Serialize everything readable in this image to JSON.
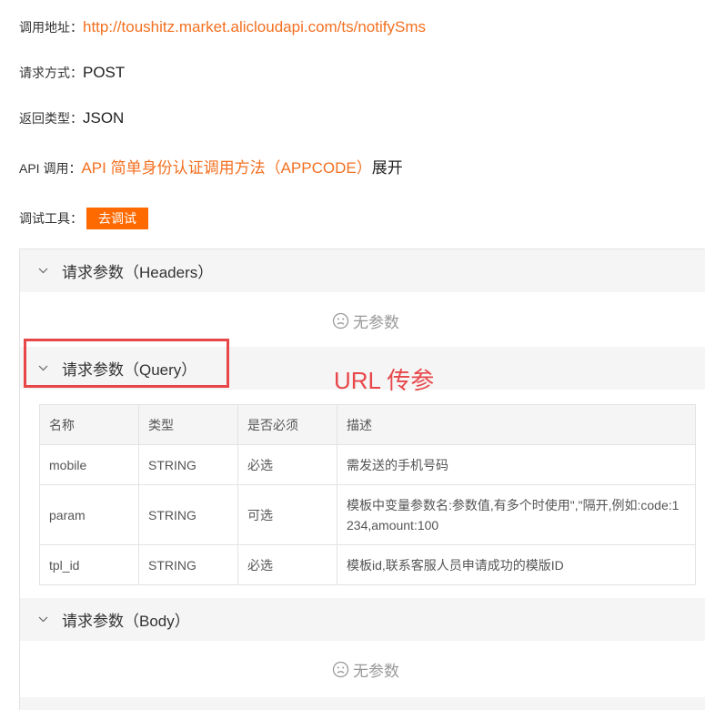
{
  "info": {
    "url_label": "调用地址：",
    "url_value": "http://toushitz.market.alicloudapi.com/ts/notifySms",
    "method_label": "请求方式：",
    "method_value": "POST",
    "return_label": "返回类型：",
    "return_value": "JSON",
    "api_label": "API 调用：",
    "api_link": "API 简单身份认证调用方法（APPCODE）",
    "api_expand": "展开",
    "tool_label": "调试工具：",
    "tool_button": "去调试"
  },
  "sections": {
    "headers_title": "请求参数（Headers）",
    "headers_empty": "无参数",
    "query_title": "请求参数（Query）",
    "body_title": "请求参数（Body）",
    "body_empty": "无参数"
  },
  "table": {
    "columns": [
      "名称",
      "类型",
      "是否必须",
      "描述"
    ],
    "rows": [
      {
        "name": "mobile",
        "type": "STRING",
        "required": "必选",
        "desc": "需发送的手机号码"
      },
      {
        "name": "param",
        "type": "STRING",
        "required": "可选",
        "desc": "模板中变量参数名:参数值,有多个时使用\",\"隔开,例如:code:1234,amount:100"
      },
      {
        "name": "tpl_id",
        "type": "STRING",
        "required": "必选",
        "desc": "模板id,联系客服人员申请成功的模版ID"
      }
    ]
  },
  "annotation": {
    "text": "URL 传参",
    "color": "#e8474a"
  },
  "colors": {
    "accent": "#ff6a00",
    "link": "#f37021"
  },
  "icons": {
    "chevron": "chevron-down-icon",
    "empty": "sad-face-icon"
  }
}
